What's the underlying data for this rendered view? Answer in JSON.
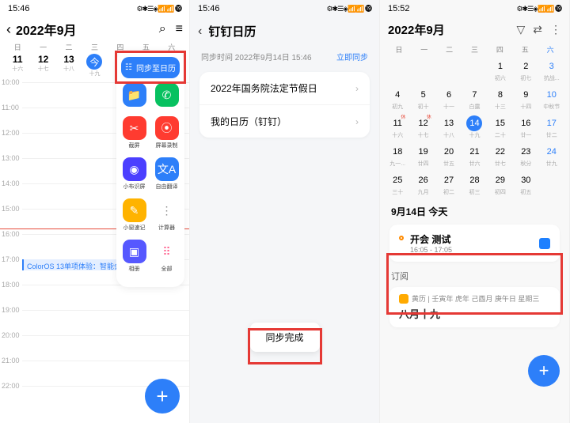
{
  "status": {
    "time1": "15:46",
    "time2": "15:46",
    "time3": "15:52",
    "icons": "⚙✱☰◈📶📶 ⓳"
  },
  "phone1": {
    "title": "2022年9月",
    "week": [
      "日",
      "一",
      "二",
      "三",
      "四",
      "五",
      "六"
    ],
    "dates": [
      {
        "n": "11",
        "s": "十六"
      },
      {
        "n": "12",
        "s": "十七"
      },
      {
        "n": "13",
        "s": "十八"
      },
      {
        "n": "今",
        "s": "十九",
        "today": true
      }
    ],
    "hours": [
      "10:00",
      "11:00",
      "12:00",
      "13:00",
      "14:00",
      "15:00",
      "16:00",
      "17:00",
      "18:00",
      "19:00",
      "20:00",
      "21:00",
      "22:00"
    ],
    "now": "15:46",
    "event": "ColorOS 13单项体验：智能会...",
    "fab": "+",
    "panel": {
      "sync": "同步至日历",
      "rows": [
        [
          {
            "label": "",
            "color": "#2d7ff9",
            "glyph": "📁"
          },
          {
            "label": "",
            "color": "#07c160",
            "glyph": "✆"
          }
        ],
        [
          {
            "label": "截屏",
            "color": "#ff3b30",
            "glyph": "✂"
          },
          {
            "label": "屏幕录制",
            "color": "#ff3b30",
            "glyph": "⦿"
          }
        ],
        [
          {
            "label": "小布识屏",
            "color": "#4b3fff",
            "glyph": "◉"
          },
          {
            "label": "自由翻译",
            "color": "#2d7ff9",
            "glyph": "文A"
          }
        ],
        [
          {
            "label": "小窗速记",
            "color": "#ffb300",
            "glyph": "✎"
          },
          {
            "label": "计算器",
            "color": "#fff",
            "glyph": "⋮",
            "fg": "#888"
          }
        ],
        [
          {
            "label": "相册",
            "color": "#5658ff",
            "glyph": "▣"
          },
          {
            "label": "全部",
            "color": "#fff",
            "glyph": "⠿",
            "fg": "#ff5d8c"
          }
        ]
      ]
    }
  },
  "phone2": {
    "title": "钉钉日历",
    "sync_time_label": "同步时间 2022年9月14日 15:46",
    "sync_now": "立即同步",
    "items": [
      "2022年国务院法定节假日",
      "我的日历（钉钉）"
    ],
    "toast": "同步完成"
  },
  "phone3": {
    "title": "2022年9月",
    "week": [
      "日",
      "一",
      "二",
      "三",
      "四",
      "五",
      "六"
    ],
    "grid": [
      [
        null,
        null,
        null,
        null,
        {
          "n": "1",
          "s": "初六"
        },
        {
          "n": "2",
          "s": "初七"
        },
        {
          "n": "3",
          "s": "抗战..."
        }
      ],
      [
        {
          "n": "4",
          "s": "初九"
        },
        {
          "n": "5",
          "s": "初十"
        },
        {
          "n": "6",
          "s": "十一"
        },
        {
          "n": "7",
          "s": "白露"
        },
        {
          "n": "8",
          "s": "十三"
        },
        {
          "n": "9",
          "s": "十四"
        },
        {
          "n": "10",
          "s": "中秋节"
        }
      ],
      [
        {
          "n": "11",
          "s": "十六",
          "badge": "休"
        },
        {
          "n": "12",
          "s": "十七",
          "badge": "休"
        },
        {
          "n": "13",
          "s": "十八"
        },
        {
          "n": "14",
          "s": "十九",
          "today": true
        },
        {
          "n": "15",
          "s": "二十"
        },
        {
          "n": "16",
          "s": "廿一"
        },
        {
          "n": "17",
          "s": "廿二"
        }
      ],
      [
        {
          "n": "18",
          "s": "九一..."
        },
        {
          "n": "19",
          "s": "廿四"
        },
        {
          "n": "20",
          "s": "廿五"
        },
        {
          "n": "21",
          "s": "廿六"
        },
        {
          "n": "22",
          "s": "廿七"
        },
        {
          "n": "23",
          "s": "秋分"
        },
        {
          "n": "24",
          "s": "廿九"
        }
      ],
      [
        {
          "n": "25",
          "s": "三十"
        },
        {
          "n": "26",
          "s": "九月"
        },
        {
          "n": "27",
          "s": "初二"
        },
        {
          "n": "28",
          "s": "初三"
        },
        {
          "n": "29",
          "s": "初四"
        },
        {
          "n": "30",
          "s": "初五"
        },
        null
      ]
    ],
    "today_header": "9月14日  今天",
    "event": {
      "title": "开会 测试",
      "time": "16:05 - 17:05"
    },
    "sub": "订阅",
    "almanac": {
      "info": "黄历 | 壬寅年 虎年 己酉月 庚午日 星期三",
      "lunar": "八月十九"
    },
    "fab": "+"
  }
}
